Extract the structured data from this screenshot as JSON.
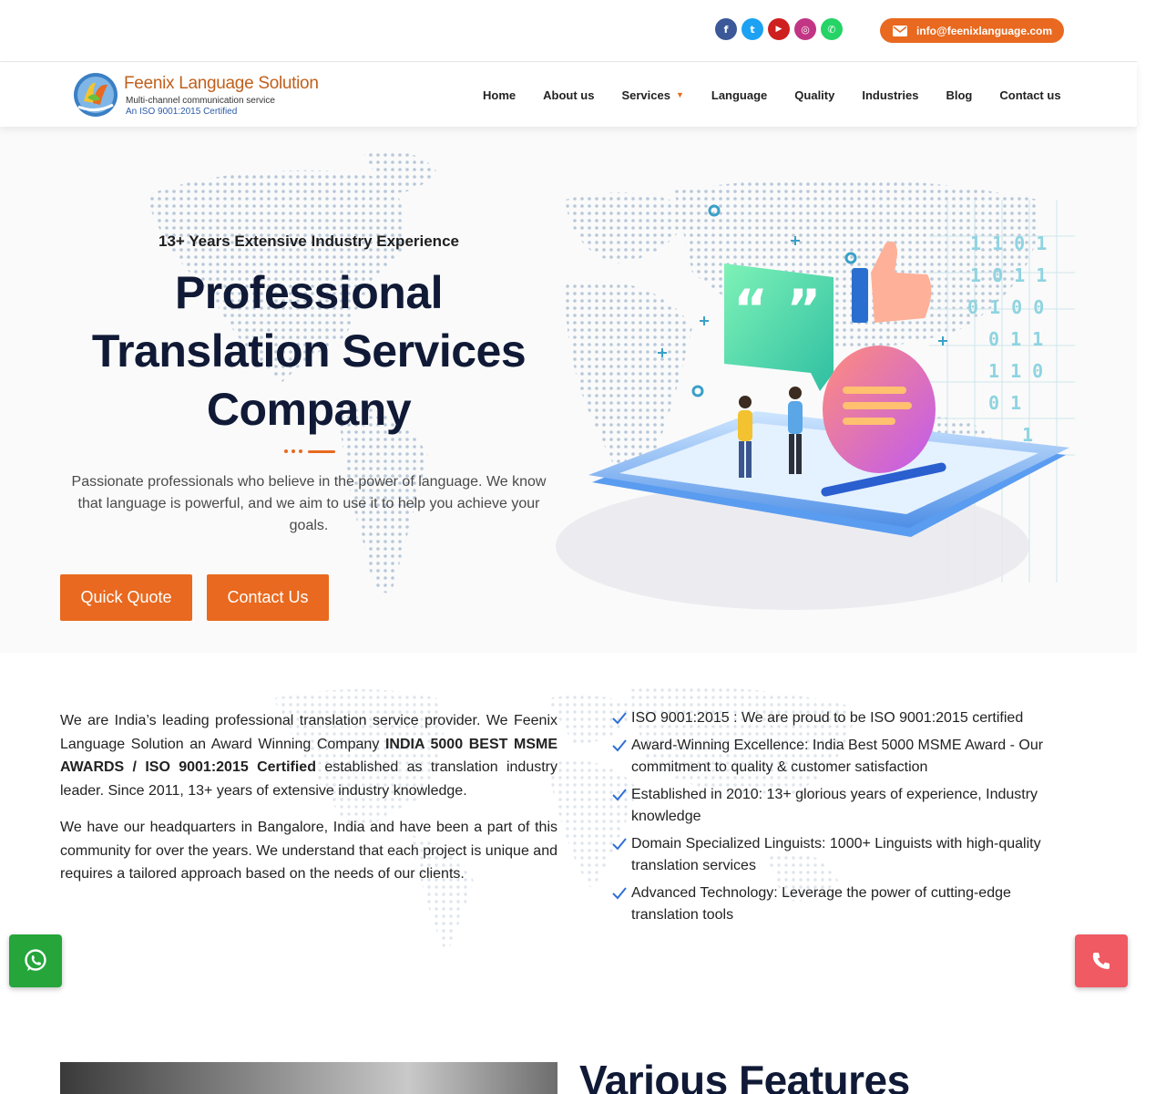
{
  "topbar": {
    "socials": [
      {
        "name": "facebook-icon",
        "glyph": "f",
        "color": "#3b5998"
      },
      {
        "name": "twitter-icon",
        "glyph": "t",
        "color": "#1da1f2"
      },
      {
        "name": "youtube-icon",
        "glyph": "▶",
        "color": "#cd201f"
      },
      {
        "name": "instagram-icon",
        "glyph": "◎",
        "color": "#c13584"
      },
      {
        "name": "whatsapp-icon",
        "glyph": "✆",
        "color": "#25d366"
      }
    ],
    "email": "info@feenixlanguage.com"
  },
  "logo": {
    "title": "Feenix Language Solution",
    "subtitle": "Multi-channel communication service",
    "iso": "An ISO 9001:2015 Certified"
  },
  "nav": {
    "items": [
      "Home",
      "About us",
      "Services",
      "Language",
      "Quality",
      "Industries",
      "Blog",
      "Contact us"
    ]
  },
  "hero": {
    "kicker": "13+ Years Extensive Industry Experience",
    "title_line1": "Professional",
    "title_line2": "Translation Services",
    "title_line3": "Company",
    "lead": "Passionate professionals who believe in the power of language. We know that language is powerful, and we aim to use it to help you achieve your goals.",
    "btn_quote": "Quick Quote",
    "btn_contact": "Contact Us",
    "binary": [
      "1 1 0 1",
      "1 0 1 1",
      "0 1 0 0",
      "0 1 1",
      "1 1 0",
      "0 1",
      "1"
    ]
  },
  "about": {
    "p1_a": "We are India’s leading professional translation service provider. We Feenix Language Solution an Award Winning Company ",
    "p1_b": "INDIA 5000 BEST MSME AWARDS / ISO 9001:2015 Certified",
    "p1_c": " established as translation industry leader. Since 2011, 13+ years of extensive industry knowledge.",
    "p2": "We have our headquarters in Bangalore, India and have been a part of this community for over the years. We understand that each project is unique and requires a tailored approach based on the needs of our clients.",
    "checks": [
      "ISO 9001:2015 : We are proud to be ISO 9001:2015 certified",
      "Award-Winning Excellence: India Best 5000 MSME Award - Our commitment to quality & customer satisfaction",
      "Established in 2010: 13+ glorious years of experience, Industry knowledge",
      "Domain Specialized Linguists: 1000+ Linguists with high-quality translation services",
      "Advanced Technology: Leverage the power of cutting-edge translation tools"
    ]
  },
  "features": {
    "title": "Various Features"
  },
  "colors": {
    "accent": "#e8691f",
    "navy": "#101a36",
    "whatsapp": "#25a53a",
    "call": "#ef5a63"
  }
}
